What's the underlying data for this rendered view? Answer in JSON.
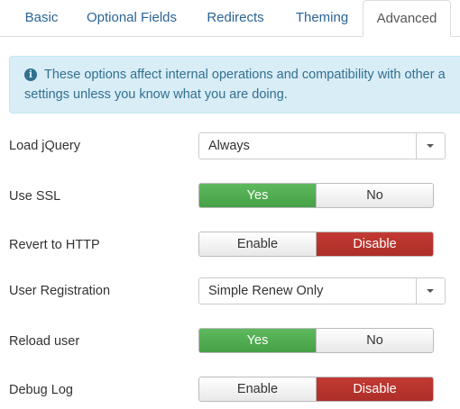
{
  "tabs": [
    {
      "label": "Basic",
      "active": false
    },
    {
      "label": "Optional Fields",
      "active": false
    },
    {
      "label": "Redirects",
      "active": false
    },
    {
      "label": "Theming",
      "active": false
    },
    {
      "label": "Advanced",
      "active": true
    }
  ],
  "alert": {
    "icon": "info-icon",
    "line1": "These options affect internal operations and compatibility with other a",
    "line2": "settings unless you know what you are doing."
  },
  "fields": {
    "load_jquery": {
      "label": "Load jQuery",
      "value": "Always"
    },
    "use_ssl": {
      "label": "Use SSL",
      "option_a": "Yes",
      "option_b": "No",
      "selected": "Yes"
    },
    "revert_http": {
      "label": "Revert to HTTP",
      "option_a": "Enable",
      "option_b": "Disable",
      "selected": "Disable"
    },
    "user_registration": {
      "label": "User Registration",
      "value": "Simple Renew Only"
    },
    "reload_user": {
      "label": "Reload user",
      "option_a": "Yes",
      "option_b": "No",
      "selected": "Yes"
    },
    "debug_log": {
      "label": "Debug Log",
      "option_a": "Enable",
      "option_b": "Disable",
      "selected": "Disable"
    }
  },
  "colors": {
    "active_green": "#51a351",
    "active_red": "#bd362f",
    "link_blue": "#2a6496",
    "alert_bg": "#d9edf7"
  }
}
